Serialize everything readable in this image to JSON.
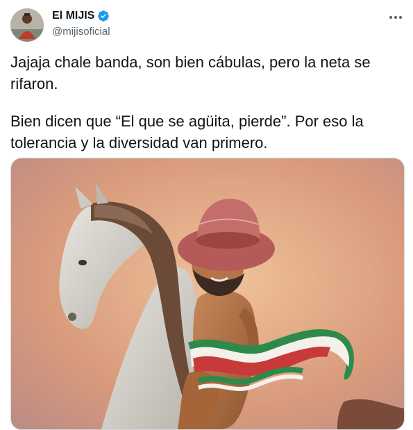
{
  "author": {
    "display_name": "El MIJIS",
    "handle": "@mijisoficial",
    "verified": true,
    "avatar_icon": "user-avatar"
  },
  "tweet": {
    "paragraphs": [
      "Jajaja chale banda, son bien cábulas, pero la neta se rifaron.",
      "Bien dicen que “El que se agüita, pierde”. Por eso la tolerancia y la diversidad van primero."
    ]
  },
  "media": {
    "description_icon": "painting-image"
  },
  "colors": {
    "verified_blue": "#1d9bf0",
    "text_primary": "#0f1419",
    "text_secondary": "#536471"
  }
}
